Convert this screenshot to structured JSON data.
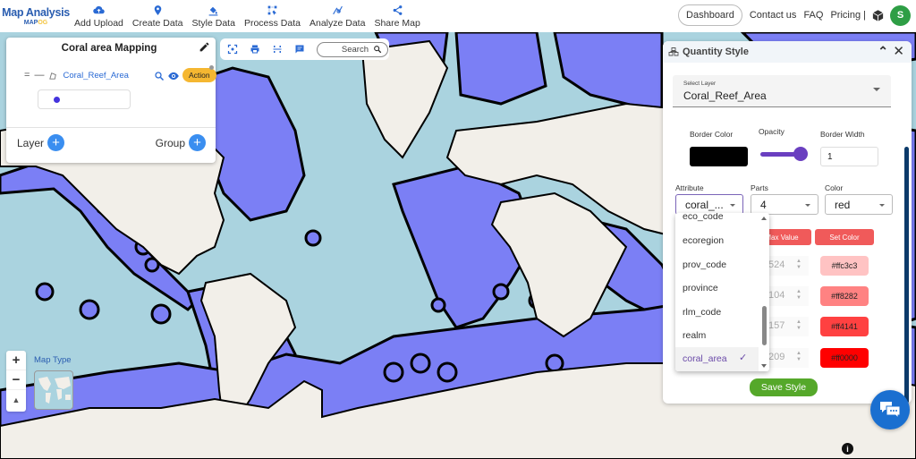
{
  "brand": {
    "title": "Map Analysis",
    "sub_a": "MAP",
    "sub_b": "OG"
  },
  "nav": [
    {
      "label": "Add Upload",
      "icon": "cloud-upload-icon"
    },
    {
      "label": "Create Data",
      "icon": "map-pin-icon"
    },
    {
      "label": "Style Data",
      "icon": "paint-bucket-icon"
    },
    {
      "label": "Process Data",
      "icon": "process-icon"
    },
    {
      "label": "Analyze Data",
      "icon": "analyze-icon"
    },
    {
      "label": "Share Map",
      "icon": "share-icon"
    }
  ],
  "top_right": {
    "dashboard": "Dashboard",
    "contact": "Contact us",
    "faq": "FAQ",
    "pricing": "Pricing |",
    "avatar_initial": "S"
  },
  "layer_panel": {
    "title": "Coral area Mapping",
    "layer_handle": "= —",
    "layer_name": "Coral_Reef_Area",
    "action_label": "Action",
    "layer_label": "Layer",
    "group_label": "Group",
    "plus": "+"
  },
  "map_toolbar": {
    "search_label": "Search"
  },
  "map_controls": {
    "zoom_in": "+",
    "zoom_out": "−",
    "compass": "▲",
    "map_type_label": "Map Type"
  },
  "info": "i",
  "quantity_style": {
    "title": "Quantity Style",
    "collapse": "⌃",
    "close": "✕",
    "select_layer_label": "Select Layer",
    "select_layer_value": "Coral_Reef_Area",
    "border_color_label": "Border Color",
    "border_color": "#000000",
    "opacity_label": "Opacity",
    "opacity_value": 1.0,
    "border_width_label": "Border Width",
    "border_width_value": "1",
    "attribute_label": "Attribute",
    "attribute_value": "coral_...",
    "parts_label": "Parts",
    "parts_value": "4",
    "color_label": "Color",
    "color_value": "red",
    "max_value_header": "Max Value",
    "set_color_header": "Set Color",
    "rows": [
      {
        "max": "524",
        "color": "#ffc3c3"
      },
      {
        "max": "104",
        "color": "#ff8282"
      },
      {
        "max": "157",
        "color": "#ff4141"
      },
      {
        "max": "209",
        "color": "#ff0000"
      }
    ],
    "save_label": "Save Style"
  },
  "attribute_dropdown": {
    "options": [
      "eco_code",
      "ecoregion",
      "prov_code",
      "province",
      "rlm_code",
      "realm",
      "coral_area"
    ],
    "selected": "coral_area",
    "check": "✓"
  }
}
